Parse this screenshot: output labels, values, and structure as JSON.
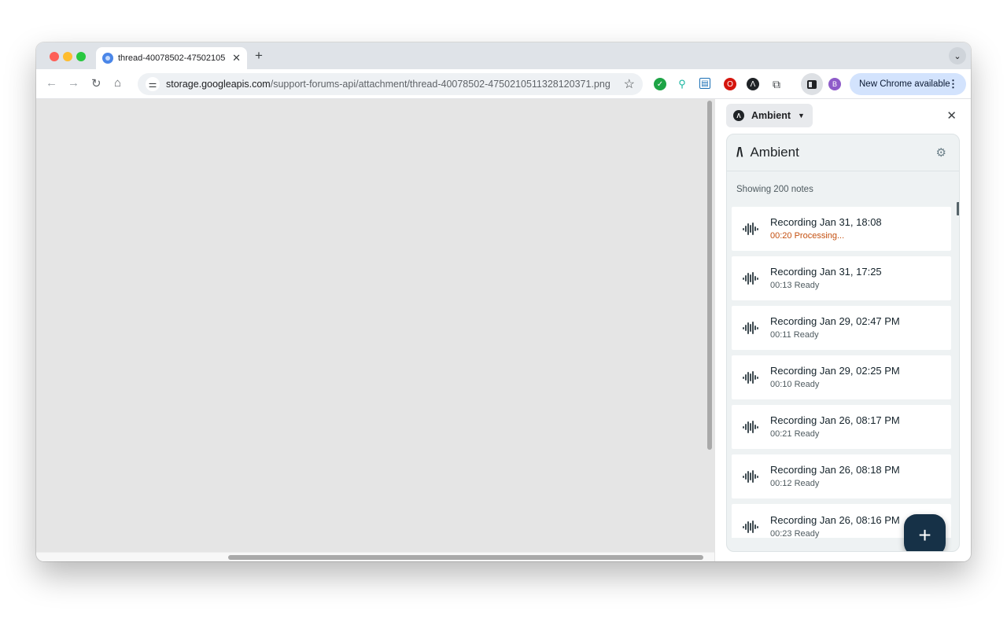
{
  "browser": {
    "tab_title": "thread-40078502-47502105",
    "new_tab_symbol": "+",
    "url_host": "storage.googleapis.com",
    "url_path": "/support-forums-api/attachment/thread-40078502-4750210511328120371.png",
    "profile_initial": "B",
    "update_label": "New Chrome available"
  },
  "side_panel": {
    "selector_label": "Ambient",
    "app": {
      "title": "Ambient",
      "count_text": "Showing 200 notes",
      "recordings": [
        {
          "title": "Recording Jan 31, 18:08",
          "status": "00:20 Processing...",
          "processing": true
        },
        {
          "title": "Recording Jan 31, 17:25",
          "status": "00:13 Ready"
        },
        {
          "title": "Recording Jan 29, 02:47 PM",
          "status": "00:11 Ready"
        },
        {
          "title": "Recording Jan 29, 02:25 PM",
          "status": "00:10 Ready"
        },
        {
          "title": "Recording Jan 26, 08:17 PM",
          "status": "00:21 Ready"
        },
        {
          "title": "Recording Jan 26, 08:18 PM",
          "status": "00:12 Ready"
        },
        {
          "title": "Recording Jan 26, 08:16 PM",
          "status": "00:23 Ready"
        }
      ],
      "fab_symbol": "+"
    }
  },
  "colors": {
    "processing": "#c44f0f",
    "fab": "#163147",
    "update_button": "#d3e3fd"
  }
}
